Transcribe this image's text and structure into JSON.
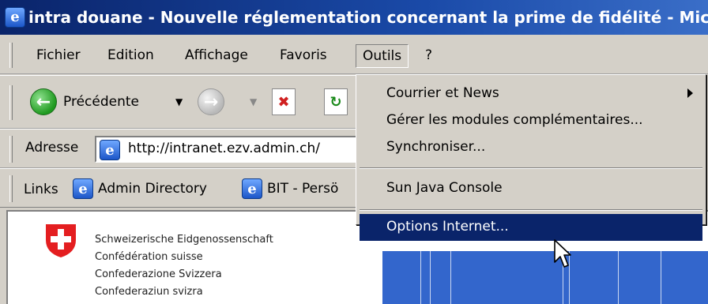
{
  "window": {
    "title": "intra douane - Nouvelle réglementation concernant la prime de fidélité - Mic"
  },
  "menubar": {
    "items": [
      "Fichier",
      "Edition",
      "Affichage",
      "Favoris",
      "Outils",
      "?"
    ]
  },
  "toolbar": {
    "back_label": "Précédente"
  },
  "addressbar": {
    "label": "Adresse",
    "url": "http://intranet.ezv.admin.ch/"
  },
  "linksbar": {
    "label": "Links",
    "items": [
      "Admin Directory",
      "BIT - Persö"
    ]
  },
  "content": {
    "confederation_lines": [
      "Schweizerische Eidgenossenschaft",
      "Confédération suisse",
      "Confederazione Svizzera",
      "Confederaziun svizra"
    ]
  },
  "tools_menu": {
    "items": [
      {
        "label": "Courrier et News",
        "submenu": true
      },
      {
        "label": "Gérer les modules complémentaires..."
      },
      {
        "label": "Synchroniser..."
      },
      {
        "label": "Sun Java Console"
      },
      {
        "label": "Options Internet...",
        "highlighted": true
      }
    ]
  },
  "colors": {
    "titlebar": "#0a246a",
    "highlight": "#0a246a",
    "chrome": "#d4d0c8",
    "content_blue": "#3366cc"
  }
}
